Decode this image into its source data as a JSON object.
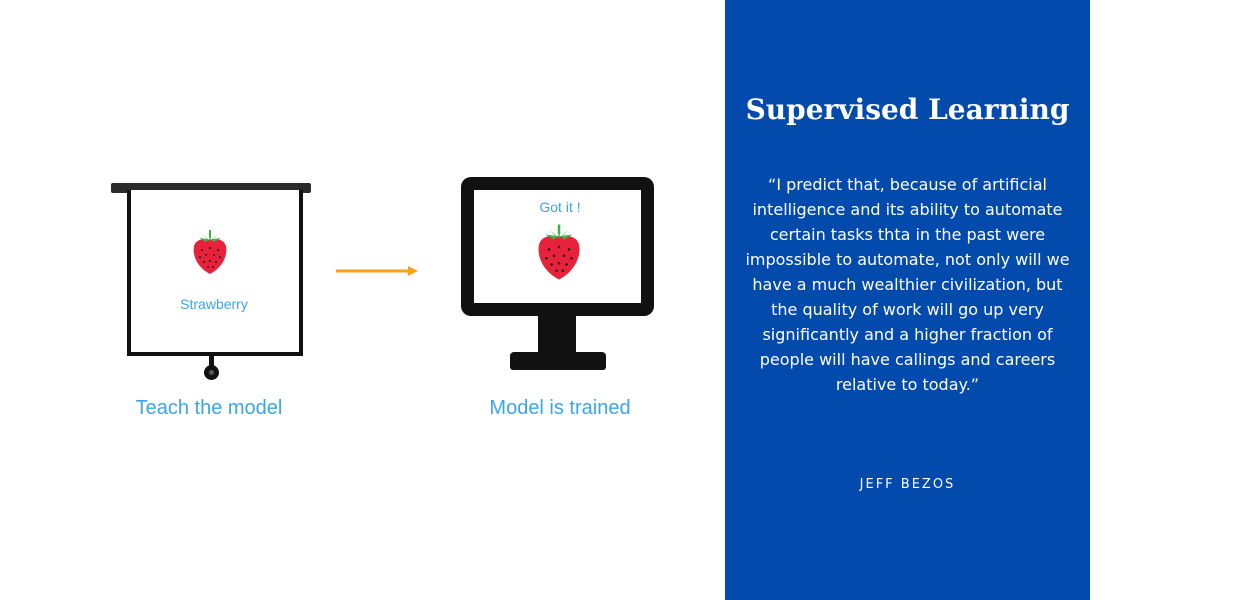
{
  "diagram": {
    "screen_label": "Strawberry",
    "monitor_label": "Got it !",
    "caption_left": "Teach the model",
    "caption_right": "Model is trained",
    "colors": {
      "label_blue": "#3aa6e8",
      "arrow_orange": "#f7a21b",
      "berry_red": "#e8223a",
      "leaf_green": "#39b54a"
    },
    "icons": [
      "strawberry-icon",
      "projector-screen-icon",
      "monitor-icon",
      "arrow-right-icon"
    ]
  },
  "panel": {
    "title": "Supervised Learning",
    "quote": "“I predict that, because of artificial intelligence and its ability to automate certain tasks thta in the past were impossible to automate, not only will we have a much wealthier civilization, but the quality of work will go up very significantly and a higher fraction of people will have callings and careers relative to today.”",
    "author": "JEFF BEZOS",
    "background": "#034aad"
  }
}
